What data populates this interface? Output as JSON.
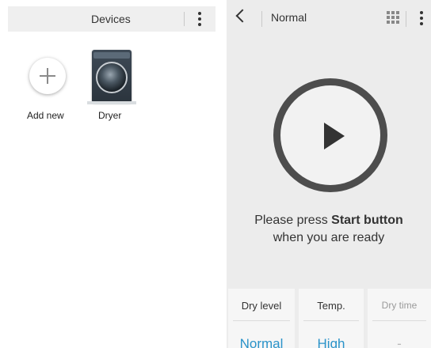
{
  "left_panel": {
    "header_title": "Devices",
    "devices": [
      {
        "label": "Add new",
        "icon": "plus-icon"
      },
      {
        "label": "Dryer",
        "icon": "dryer-image"
      }
    ]
  },
  "right_panel": {
    "header_title": "Normal",
    "prompt": {
      "line1_prefix": "Please press ",
      "line1_bold": "Start button",
      "line2": "when you are ready"
    },
    "settings": [
      {
        "title": "Dry level",
        "value": "Normal"
      },
      {
        "title": "Temp.",
        "value": "High"
      },
      {
        "title": "Dry time",
        "value": "-"
      }
    ]
  },
  "colors": {
    "accent": "#2a93c9",
    "panel_bg": "#ececec",
    "header_bg": "#efefef"
  }
}
